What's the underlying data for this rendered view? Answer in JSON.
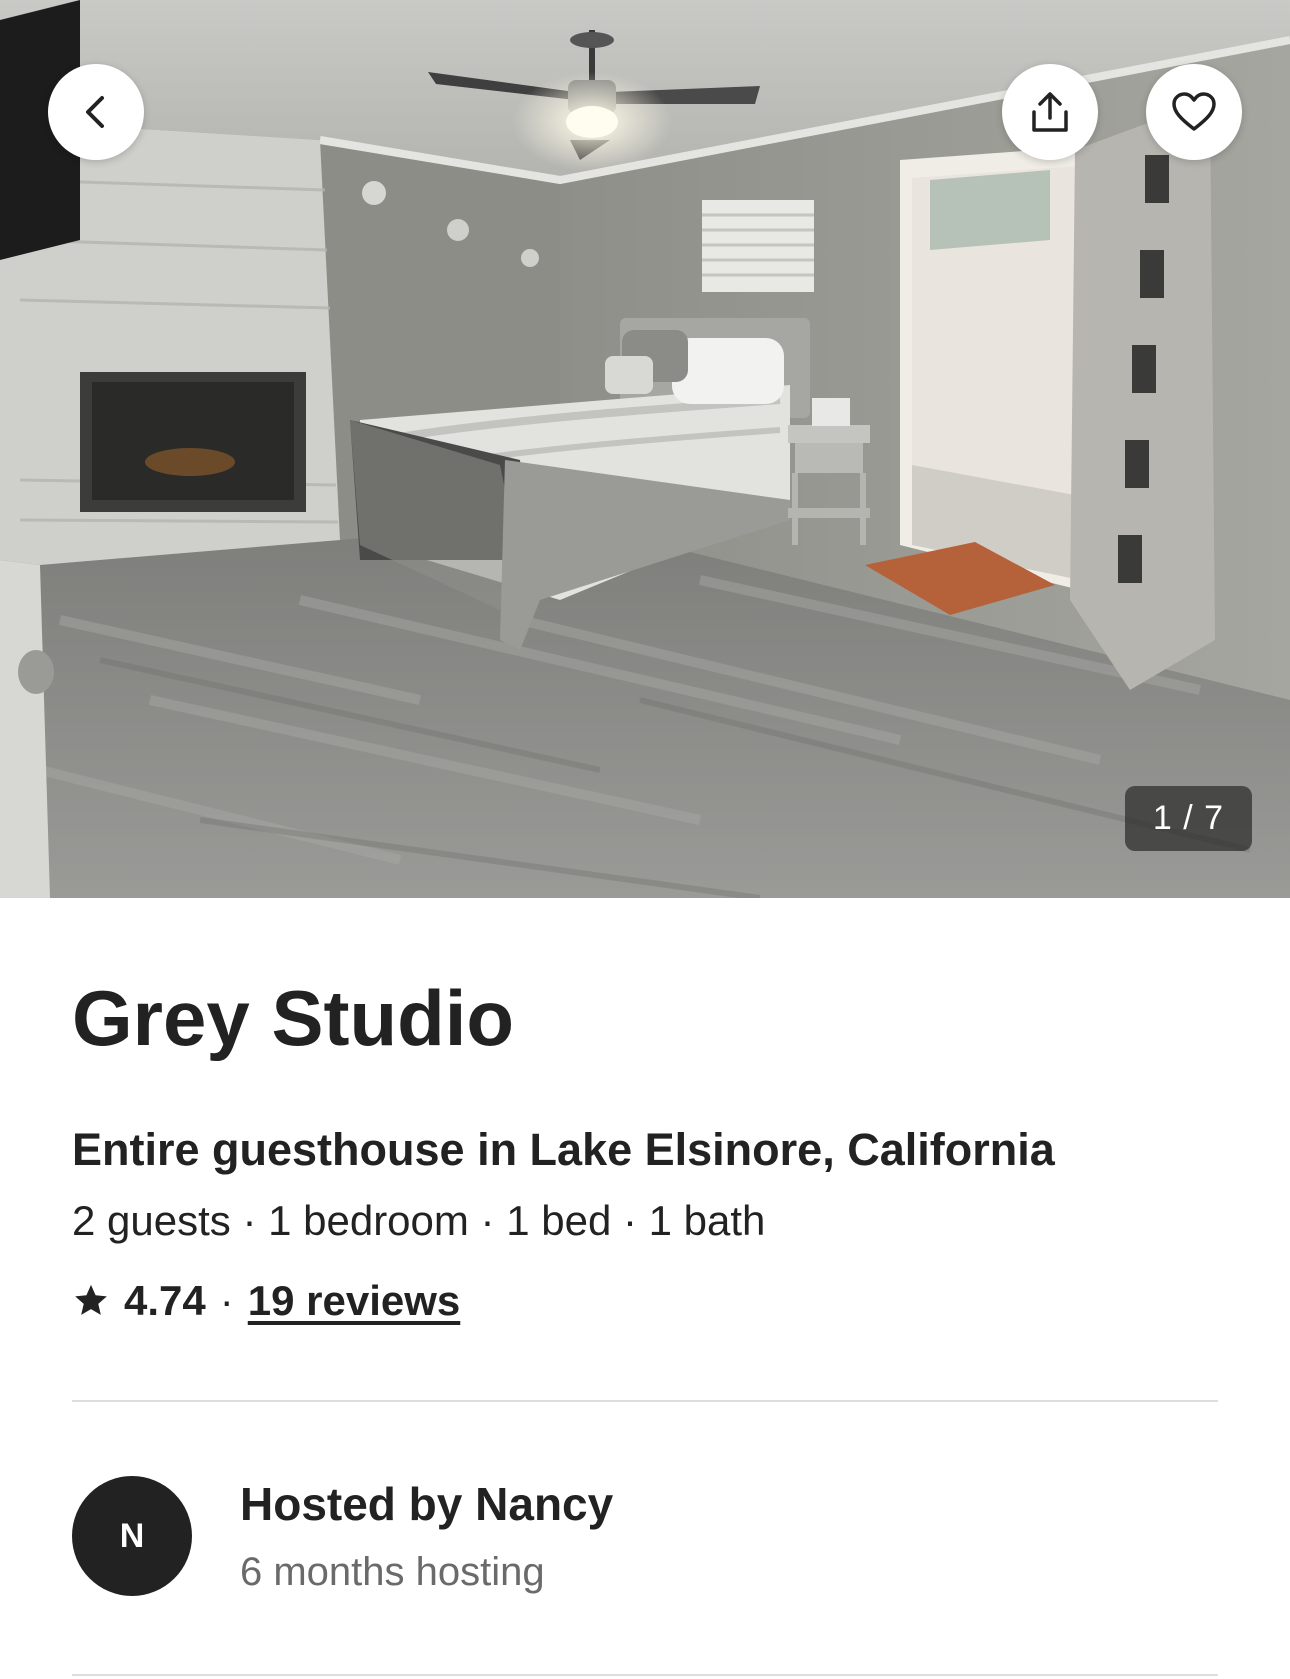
{
  "listing": {
    "title": "Grey Studio",
    "subtitle": "Entire guesthouse in Lake Elsinore, California",
    "details": "2 guests · 1 bedroom · 1 bed · 1 bath",
    "rating": "4.74",
    "rating_separator": "·",
    "reviews_label": "19 reviews"
  },
  "gallery": {
    "counter": "1 / 7",
    "current_index": 1,
    "total_photos": 7,
    "photo_subject": "bedroom with fireplace, bed, nightstand and open door"
  },
  "host": {
    "initial": "N",
    "title": "Hosted by Nancy",
    "tenure": "6 months hosting"
  },
  "buttons": {
    "back_icon": "chevron-left-icon",
    "share_icon": "share-icon",
    "save_icon": "heart-icon"
  },
  "colors": {
    "text_primary": "#222222",
    "text_secondary": "#6a6a6a",
    "divider": "#dddddd",
    "avatar_bg": "#222222"
  }
}
